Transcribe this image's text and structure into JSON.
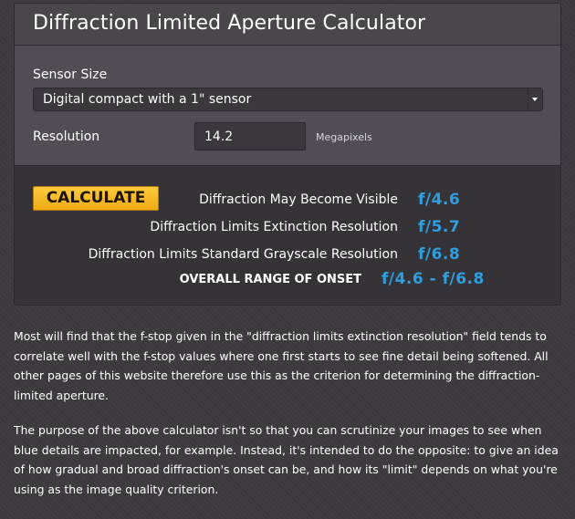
{
  "panel": {
    "title": "Diffraction Limited Aperture Calculator"
  },
  "inputs": {
    "sensor_label": "Sensor Size",
    "sensor_selected": "Digital compact with a 1\" sensor",
    "resolution_label": "Resolution",
    "resolution_value": "14.2",
    "resolution_unit": "Megapixels"
  },
  "results": {
    "calculate_label": "CALCULATE",
    "rows": [
      {
        "label": "Diffraction May Become Visible",
        "value": "f/4.6"
      },
      {
        "label": "Diffraction Limits Extinction Resolution",
        "value": "f/5.7"
      },
      {
        "label": "Diffraction Limits Standard Grayscale Resolution",
        "value": "f/6.8"
      }
    ],
    "overall_label": "OVERALL RANGE OF ONSET",
    "overall_value": "f/4.6 - f/6.8"
  },
  "body_text": {
    "paragraph1": "Most will find that the f-stop given in the \"diffraction limits extinction resolution\" field tends to correlate well with the f-stop values where one first starts to see fine detail being softened. All other pages of this website therefore use this as the criterion for determining the diffraction-limited aperture.",
    "paragraph2": "The purpose of the above calculator isn't so that you can scrutinize your images to see when blue details are impacted, for example. Instead, it's intended to do the opposite: to give an idea of how gradual and broad diffraction's onset can be, and how its \"limit\" depends on what you're using as the image quality criterion."
  },
  "colors": {
    "accent_blue": "#2e9fdf",
    "button_orange": "#f7b928",
    "background": "#3b393e"
  }
}
